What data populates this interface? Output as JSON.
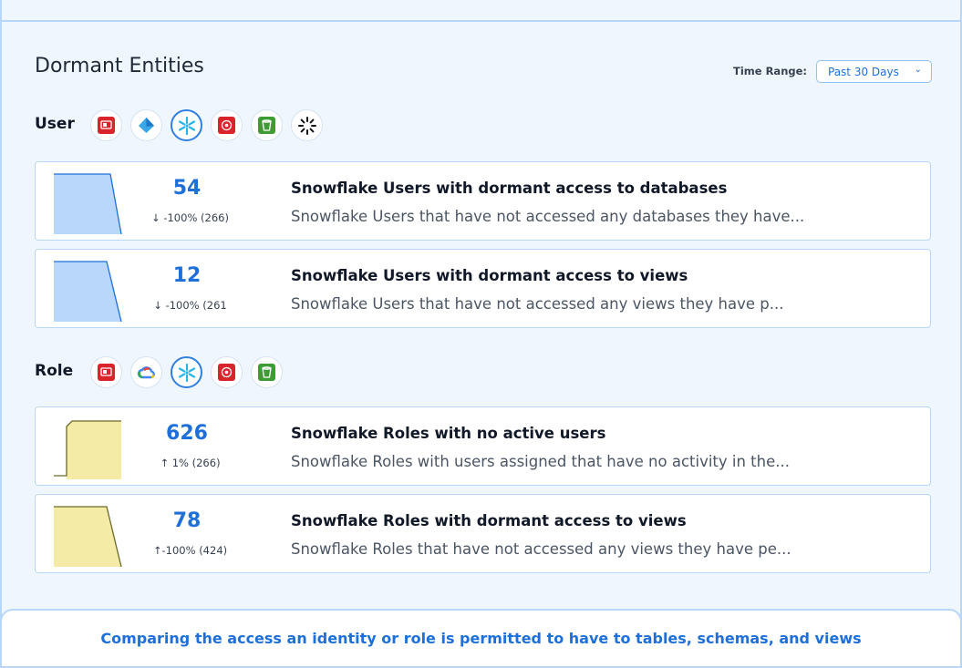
{
  "header": {
    "title": "Dormant Entities",
    "time_range_label": "Time Range:",
    "time_range_value": "Past 30 Days"
  },
  "sections": [
    {
      "label": "User",
      "sources": [
        "oracle-icon",
        "azure-icon",
        "snowflake-icon",
        "aws-iam-icon",
        "aws-s3-icon",
        "databricks-icon"
      ],
      "active_source": "snowflake-icon",
      "cards": [
        {
          "value": "54",
          "delta": "-100% (266)",
          "trend": "down",
          "title": "Snowflake Users with dormant access to databases",
          "description": "Snowflake Users that have not accessed any databases they have..."
        },
        {
          "value": "12",
          "delta": "-100% (261",
          "trend": "down",
          "title": "Snowflake Users with dormant access to views",
          "description": "Snowflake Users that have not accessed any views they have p..."
        }
      ]
    },
    {
      "label": "Role",
      "sources": [
        "oracle-icon",
        "google-cloud-icon",
        "snowflake-icon",
        "aws-iam-icon",
        "aws-s3-icon"
      ],
      "active_source": "snowflake-icon",
      "cards": [
        {
          "value": "626",
          "delta": "1% (266)",
          "trend": "up",
          "title": "Snowflake Roles with no active users",
          "description": "Snowflake Roles with users assigned that have no activity in the..."
        },
        {
          "value": "78",
          "delta": "-100% (424)",
          "trend": "up",
          "title": "Snowflake Roles with dormant access to views",
          "description": "Snowflake Roles that have not accessed any views they have pe..."
        }
      ]
    }
  ],
  "footer": {
    "text": "Comparing the access an identity or role is permitted to have to tables, schemas, and views"
  },
  "colors": {
    "accent": "#1e6fd9",
    "user_spark_fill": "#b9d6fb",
    "user_spark_stroke": "#1e6fd9",
    "role_spark_fill": "#f4eba6",
    "role_spark_stroke": "#6b6a2a"
  }
}
